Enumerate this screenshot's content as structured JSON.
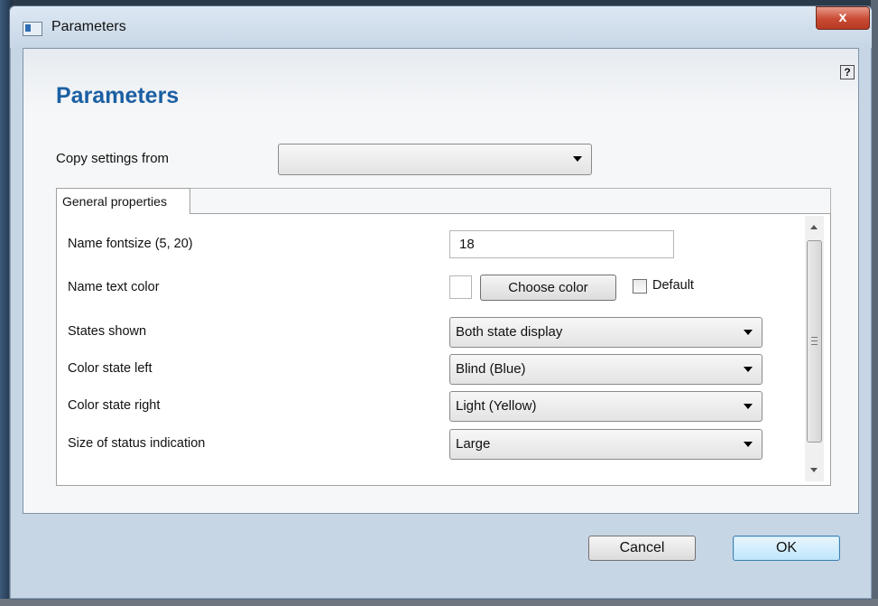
{
  "window": {
    "title": "Parameters",
    "close_glyph": "x",
    "help_glyph": "?"
  },
  "dialog": {
    "heading": "Parameters",
    "copy_settings": {
      "label": "Copy settings from",
      "value": ""
    },
    "tab": {
      "label": "General properties"
    },
    "fields": {
      "fontsize": {
        "label": "Name fontsize (5, 20)",
        "value": "18"
      },
      "text_color": {
        "label": "Name text color",
        "button": "Choose color",
        "default_label": "Default",
        "default_checked": false
      },
      "states_shown": {
        "label": "States shown",
        "value": "Both state display"
      },
      "color_left": {
        "label": "Color state left",
        "value": "Blind (Blue)"
      },
      "color_right": {
        "label": "Color state right",
        "value": "Light (Yellow)"
      },
      "status_size": {
        "label": "Size of status indication",
        "value": "Large"
      }
    }
  },
  "buttons": {
    "cancel": "Cancel",
    "ok": "OK"
  },
  "colors": {
    "heading": "#1b5fa3",
    "close": "#c94a32",
    "ok_border": "#3c7fb1"
  }
}
